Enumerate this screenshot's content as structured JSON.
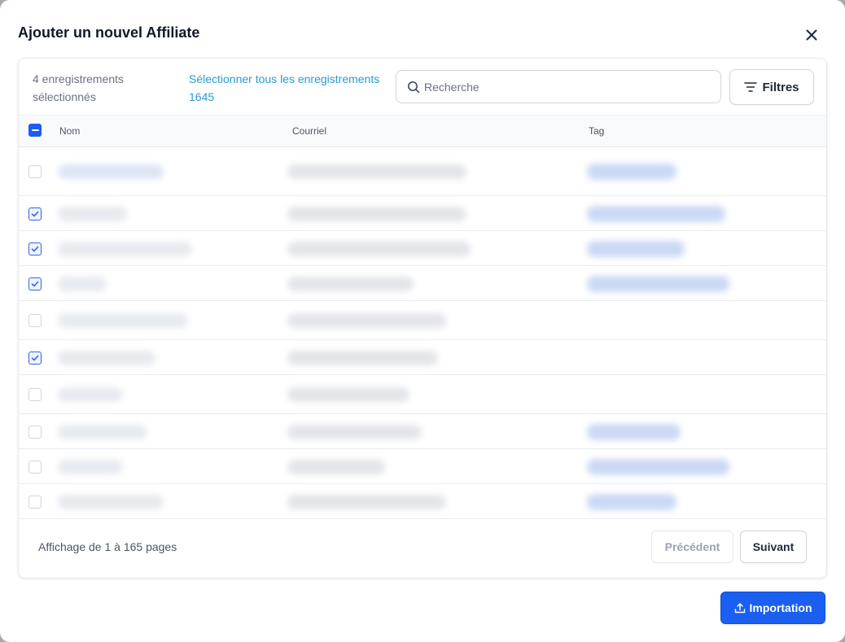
{
  "dialog": {
    "title": "Ajouter un nouvel Affiliate",
    "close_icon": "close-icon"
  },
  "toolbar": {
    "selected_count_text": "4 enregistrements sélectionnés",
    "select_all_text": "Sélectionner tous les enregistrements 1645",
    "search": {
      "placeholder": "Recherche",
      "value": "",
      "icon": "search-icon"
    },
    "filters_label": "Filtres",
    "filters_icon": "filter-lines-icon"
  },
  "table": {
    "columns": [
      "Nom",
      "Courriel",
      "Tag"
    ],
    "header_checkbox_state": "indeterminate",
    "rows": [
      {
        "checked": false,
        "tag": true
      },
      {
        "checked": true,
        "tag": true
      },
      {
        "checked": true,
        "tag": true
      },
      {
        "checked": true,
        "tag": true
      },
      {
        "checked": false,
        "tag": false
      },
      {
        "checked": true,
        "tag": false
      },
      {
        "checked": false,
        "tag": false
      },
      {
        "checked": false,
        "tag": true
      },
      {
        "checked": false,
        "tag": true
      },
      {
        "checked": false,
        "tag": true
      }
    ]
  },
  "pagination": {
    "info": "Affichage de 1 à 165 pages",
    "prev_label": "Précédent",
    "next_label": "Suivant"
  },
  "actions": {
    "import_label": "Importation",
    "import_icon": "upload-icon"
  },
  "colors": {
    "primary": "#1a5ff0",
    "link": "#2b9ad4",
    "checkbox_checked_border": "#3563e9"
  }
}
